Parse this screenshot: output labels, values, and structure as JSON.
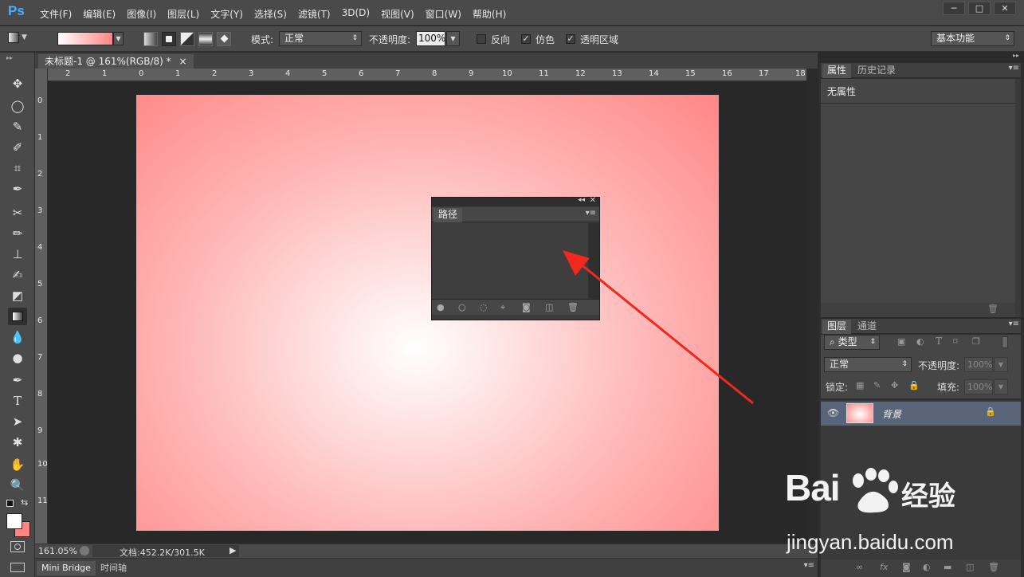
{
  "app": {
    "logo": "Ps"
  },
  "menu": [
    "文件(F)",
    "编辑(E)",
    "图像(I)",
    "图层(L)",
    "文字(Y)",
    "选择(S)",
    "滤镜(T)",
    "3D(D)",
    "视图(V)",
    "窗口(W)",
    "帮助(H)"
  ],
  "window_buttons": {
    "minimize": "─",
    "restore": "□",
    "close": "✕"
  },
  "options": {
    "mode_label": "模式:",
    "mode_value": "正常",
    "opacity_label": "不透明度:",
    "opacity_value": "100%",
    "reverse_label": "反向",
    "dither_label": "仿色",
    "transparency_label": "透明区域",
    "dither_checked": "✓",
    "transparency_checked": "✓",
    "workspace": "基本功能"
  },
  "document": {
    "tab_title": "未标题-1 @ 161%(RGB/8) *",
    "tab_close": "×"
  },
  "ruler_top": [
    "2",
    "1",
    "0",
    "1",
    "2",
    "3",
    "4",
    "5",
    "6",
    "7",
    "8",
    "9",
    "10",
    "11",
    "12",
    "13",
    "14",
    "15",
    "16",
    "17",
    "18"
  ],
  "ruler_left": [
    "0",
    "1",
    "2",
    "3",
    "4",
    "5",
    "6",
    "7",
    "8",
    "9",
    "10",
    "11"
  ],
  "paths_panel": {
    "tab": "路径"
  },
  "status": {
    "zoom": "161.05%",
    "doc_info": "文档:452.2K/301.5K"
  },
  "bottom_tabs": [
    "Mini Bridge",
    "时间轴"
  ],
  "properties_panel": {
    "tabs": [
      "属性",
      "历史记录"
    ],
    "content": "无属性"
  },
  "layers_panel": {
    "tabs": [
      "图层",
      "通道"
    ],
    "filter_kind": "类型",
    "blend_mode": "正常",
    "opacity_label": "不透明度:",
    "opacity_value": "100%",
    "lock_label": "锁定:",
    "fill_label": "填充:",
    "fill_value": "100%",
    "layers": [
      {
        "name": "背景",
        "visible": true,
        "locked": true
      }
    ]
  },
  "watermark": {
    "brand": "Bai",
    "product": "经验",
    "url": "jingyan.baidu.com"
  },
  "colors": {
    "gradient_start": "#ffffff",
    "gradient_end": "#ff8484",
    "annotation_arrow": "#f0281e",
    "selected_layer": "#5a6478"
  }
}
